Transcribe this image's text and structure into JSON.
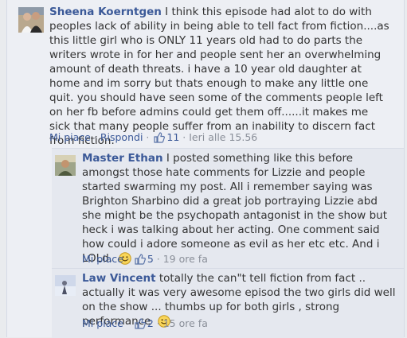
{
  "comments": [
    {
      "author": "Sheena Koerntgen",
      "text": "I think this episode had alot to do with peoples lack of ability in being able to tell fact from fiction....as this little girl who is ONLY 11 years old had to do parts the writers wrote in for her and people sent her an overwhelming amount of death threats. i have a 10 year old daughter at home and im sorry but thats enough to make any little one quit. you should have seen some of the comments people left on her fb before admins could get them off......it makes me sick that many people suffer from an inability to discern fact from fiction.",
      "like_label": "Mi piace",
      "reply_label": "Rispondi",
      "likes": "11",
      "time": "Ieri alle 15.56"
    },
    {
      "author": "Master Ethan",
      "text": "I posted something like this before amongst those hate comments for Lizzie and people started swarming my post. All i remember saying was Brighton Sharbino did a great job portraying Lizzie abd she might be the psychopath antagonist in the show but heck i was talking about her acting. One comment said how could i adore someone as evil as her etc etc. And i LOLd.",
      "like_label": "Mi piace",
      "likes": "5",
      "time": "19 ore fa"
    },
    {
      "author": "Law Vincent",
      "text": "totally the can\"t tell fiction from fact .. actually it was very awesome episod the two girls did well on the show ... thumbs up for both girls , strong performance",
      "like_label": "Mi piace",
      "likes": "2",
      "time": "15 ore fa"
    }
  ],
  "separator": "·",
  "icons": {
    "like": "thumbs-up-icon",
    "smiley": "smiley-icon"
  },
  "colors": {
    "link": "#3b5998",
    "meta": "#8a8f99",
    "text": "#333333",
    "background": "#edeff4"
  }
}
